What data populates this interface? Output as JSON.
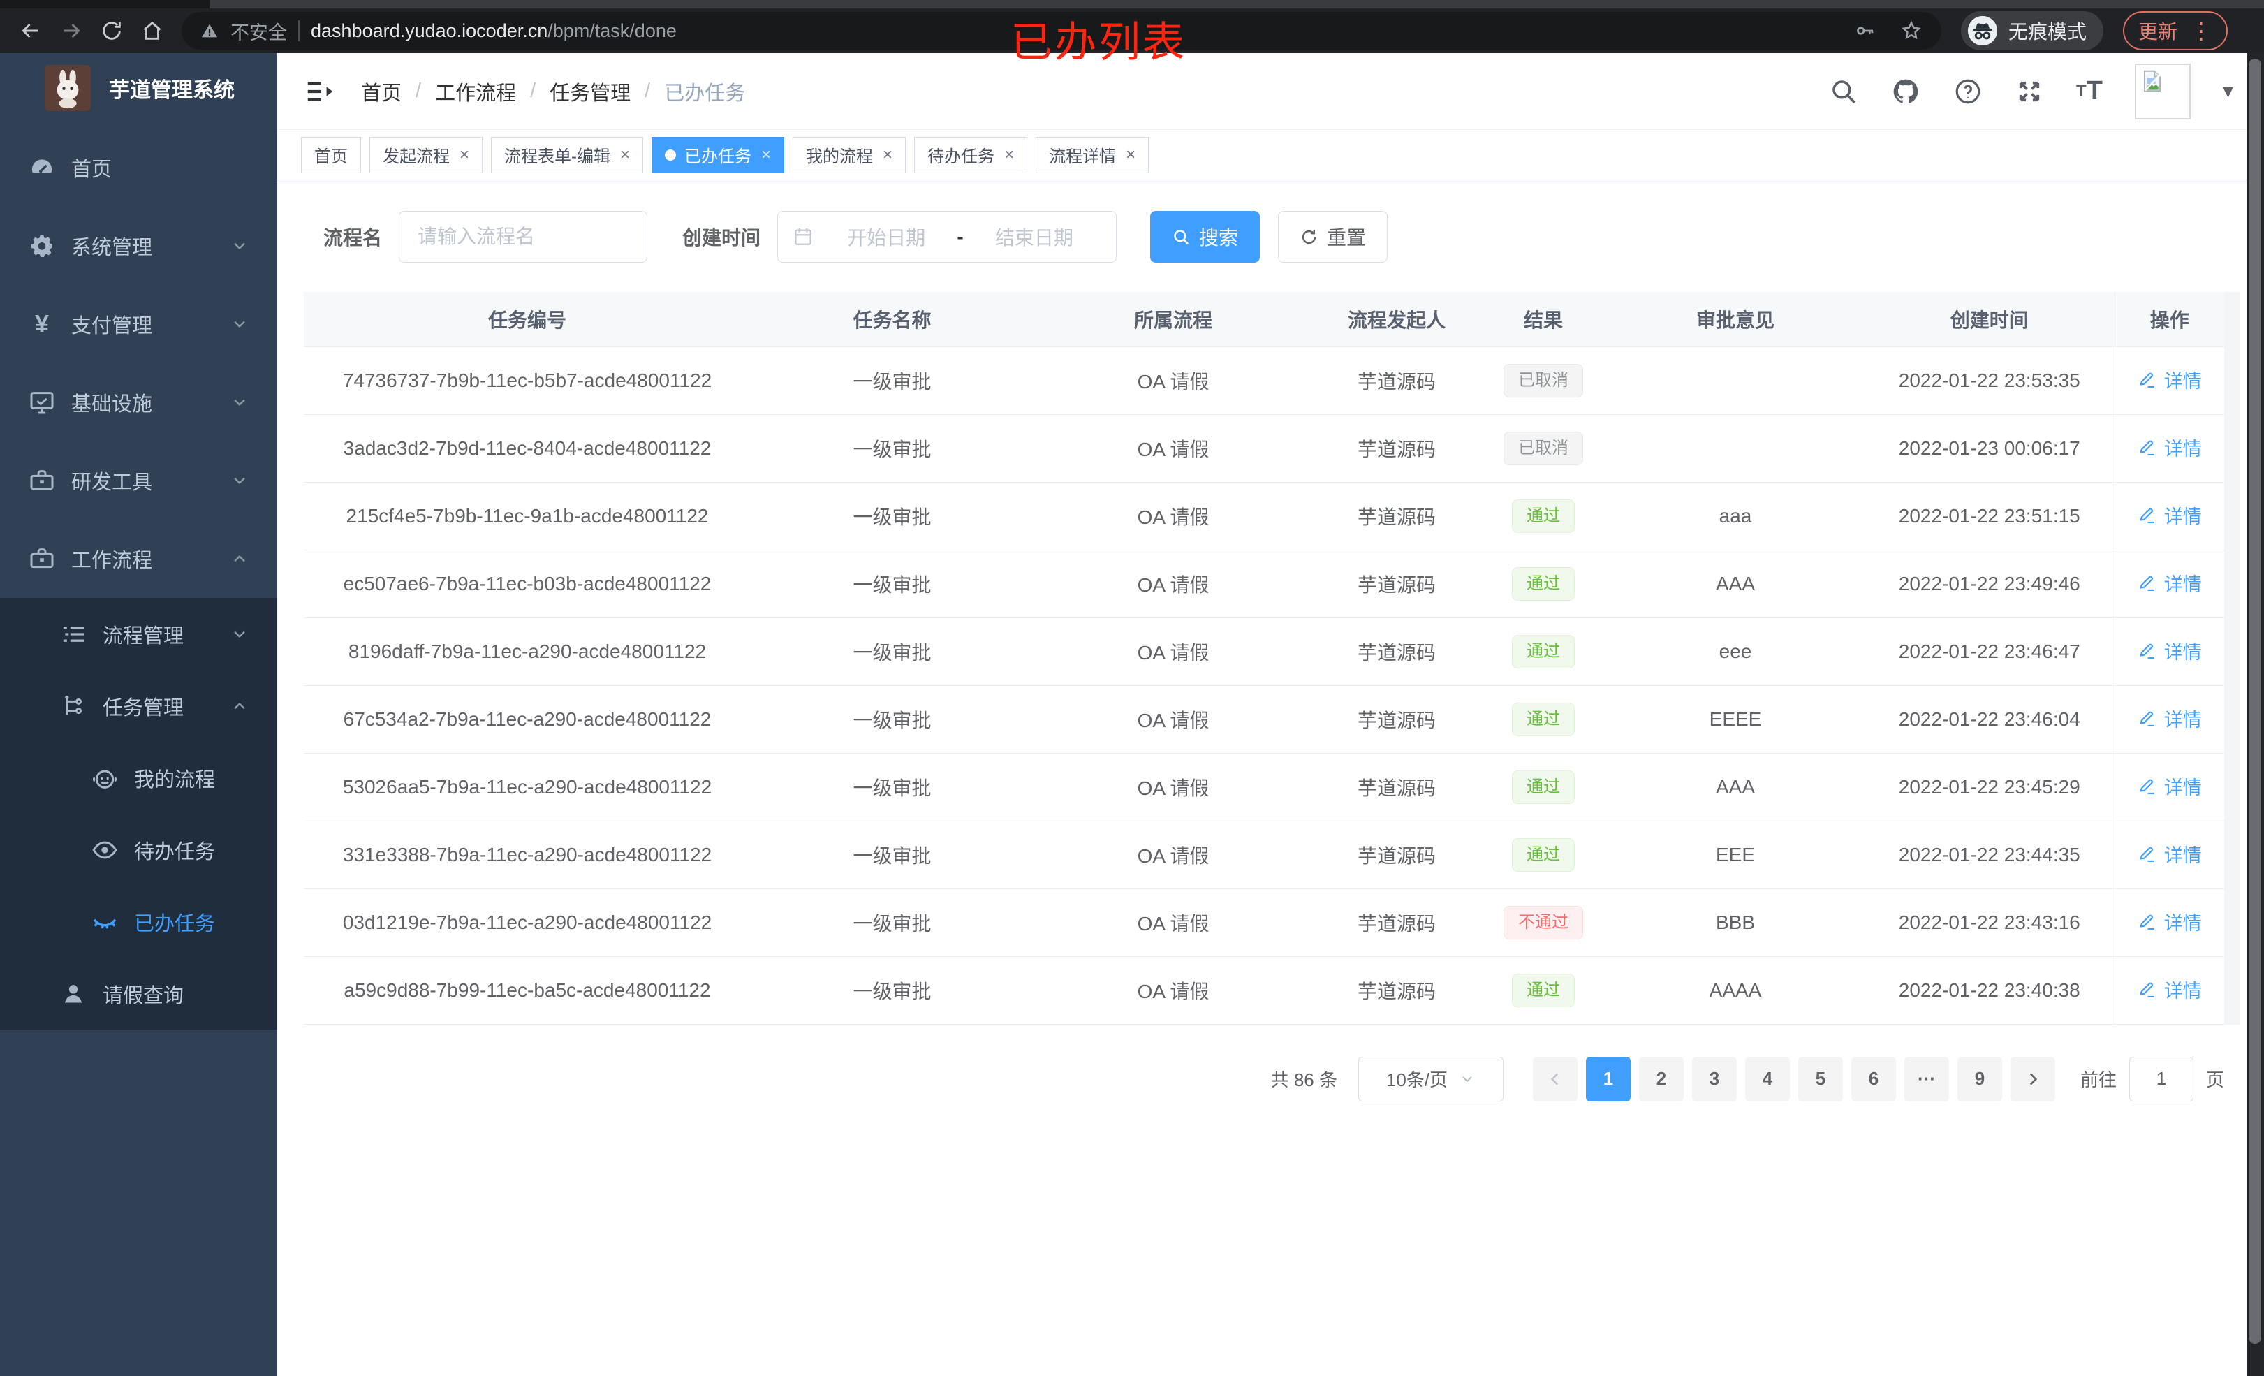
{
  "colors": {
    "accent": "#409eff",
    "success": "#67c23a",
    "danger": "#f56c6c",
    "info": "#909399",
    "sidebar": "#304156",
    "submenu": "#1f2d3d",
    "annotation": "#fb2510"
  },
  "browser": {
    "security_label": "不安全",
    "url_host": "dashboard.yudao.iocoder.cn",
    "url_path": "/bpm/task/done",
    "incognito_label": "无痕模式",
    "update_label": "更新",
    "annotation": "已办列表"
  },
  "sidebar": {
    "title": "芋道管理系统",
    "menu": [
      {
        "name": "home",
        "label": "首页",
        "icon": "dashboard-icon",
        "level": 1
      },
      {
        "name": "system",
        "label": "系统管理",
        "icon": "gear-icon",
        "level": 1,
        "arrow": "down"
      },
      {
        "name": "payment",
        "label": "支付管理",
        "icon": "yen-icon",
        "level": 1,
        "arrow": "down"
      },
      {
        "name": "infra",
        "label": "基础设施",
        "icon": "monitor-icon",
        "level": 1,
        "arrow": "down"
      },
      {
        "name": "devtools",
        "label": "研发工具",
        "icon": "toolbox-icon",
        "level": 1,
        "arrow": "down"
      },
      {
        "name": "workflow",
        "label": "工作流程",
        "icon": "toolbox-icon",
        "level": 1,
        "arrow": "up"
      },
      {
        "name": "process-mgmt",
        "label": "流程管理",
        "icon": "list-icon",
        "level": 2,
        "sub": true,
        "arrow": "down"
      },
      {
        "name": "task-mgmt",
        "label": "任务管理",
        "icon": "tree-icon",
        "level": 2,
        "sub": true,
        "arrow": "up"
      },
      {
        "name": "my-process",
        "label": "我的流程",
        "icon": "robot-icon",
        "level": 3,
        "sub": true
      },
      {
        "name": "todo-tasks",
        "label": "待办任务",
        "icon": "eye-icon",
        "level": 3,
        "sub": true
      },
      {
        "name": "done-tasks",
        "label": "已办任务",
        "icon": "eye-closed-icon",
        "level": 3,
        "sub": true,
        "active": true
      },
      {
        "name": "leave-query",
        "label": "请假查询",
        "icon": "user-icon",
        "level": 2,
        "sub": true
      }
    ]
  },
  "breadcrumb": [
    "首页",
    "工作流程",
    "任务管理",
    "已办任务"
  ],
  "tabs": [
    {
      "label": "首页",
      "closable": false,
      "active": false
    },
    {
      "label": "发起流程",
      "closable": true,
      "active": false
    },
    {
      "label": "流程表单-编辑",
      "closable": true,
      "active": false
    },
    {
      "label": "已办任务",
      "closable": true,
      "active": true
    },
    {
      "label": "我的流程",
      "closable": true,
      "active": false
    },
    {
      "label": "待办任务",
      "closable": true,
      "active": false
    },
    {
      "label": "流程详情",
      "closable": true,
      "active": false
    }
  ],
  "filters": {
    "name_label": "流程名",
    "name_placeholder": "请输入流程名",
    "time_label": "创建时间",
    "start_placeholder": "开始日期",
    "range_separator": "-",
    "end_placeholder": "结束日期",
    "search_label": "搜索",
    "reset_label": "重置"
  },
  "table": {
    "headers": [
      "任务编号",
      "任务名称",
      "所属流程",
      "流程发起人",
      "结果",
      "审批意见",
      "创建时间",
      "操作"
    ],
    "action_label": "详情",
    "rows": [
      {
        "id": "74736737-7b9b-11ec-b5b7-acde48001122",
        "task": "一级审批",
        "process": "OA 请假",
        "starter": "芋道源码",
        "result": "已取消",
        "result_type": "info",
        "comment": "",
        "time": "2022-01-22 23:53:35"
      },
      {
        "id": "3adac3d2-7b9d-11ec-8404-acde48001122",
        "task": "一级审批",
        "process": "OA 请假",
        "starter": "芋道源码",
        "result": "已取消",
        "result_type": "info",
        "comment": "",
        "time": "2022-01-23 00:06:17"
      },
      {
        "id": "215cf4e5-7b9b-11ec-9a1b-acde48001122",
        "task": "一级审批",
        "process": "OA 请假",
        "starter": "芋道源码",
        "result": "通过",
        "result_type": "success",
        "comment": "aaa",
        "time": "2022-01-22 23:51:15"
      },
      {
        "id": "ec507ae6-7b9a-11ec-b03b-acde48001122",
        "task": "一级审批",
        "process": "OA 请假",
        "starter": "芋道源码",
        "result": "通过",
        "result_type": "success",
        "comment": "AAA",
        "time": "2022-01-22 23:49:46"
      },
      {
        "id": "8196daff-7b9a-11ec-a290-acde48001122",
        "task": "一级审批",
        "process": "OA 请假",
        "starter": "芋道源码",
        "result": "通过",
        "result_type": "success",
        "comment": "eee",
        "time": "2022-01-22 23:46:47"
      },
      {
        "id": "67c534a2-7b9a-11ec-a290-acde48001122",
        "task": "一级审批",
        "process": "OA 请假",
        "starter": "芋道源码",
        "result": "通过",
        "result_type": "success",
        "comment": "EEEE",
        "time": "2022-01-22 23:46:04"
      },
      {
        "id": "53026aa5-7b9a-11ec-a290-acde48001122",
        "task": "一级审批",
        "process": "OA 请假",
        "starter": "芋道源码",
        "result": "通过",
        "result_type": "success",
        "comment": "AAA",
        "time": "2022-01-22 23:45:29"
      },
      {
        "id": "331e3388-7b9a-11ec-a290-acde48001122",
        "task": "一级审批",
        "process": "OA 请假",
        "starter": "芋道源码",
        "result": "通过",
        "result_type": "success",
        "comment": "EEE",
        "time": "2022-01-22 23:44:35"
      },
      {
        "id": "03d1219e-7b9a-11ec-a290-acde48001122",
        "task": "一级审批",
        "process": "OA 请假",
        "starter": "芋道源码",
        "result": "不通过",
        "result_type": "danger",
        "comment": "BBB",
        "time": "2022-01-22 23:43:16"
      },
      {
        "id": "a59c9d88-7b99-11ec-ba5c-acde48001122",
        "task": "一级审批",
        "process": "OA 请假",
        "starter": "芋道源码",
        "result": "通过",
        "result_type": "success",
        "comment": "AAAA",
        "time": "2022-01-22 23:40:38"
      }
    ]
  },
  "pagination": {
    "total": "共 86 条",
    "page_size": "10条/页",
    "pages": [
      "1",
      "2",
      "3",
      "4",
      "5",
      "6",
      "···",
      "9"
    ],
    "active_page": "1",
    "goto_label": "前往",
    "goto_value": "1",
    "unit_label": "页"
  }
}
